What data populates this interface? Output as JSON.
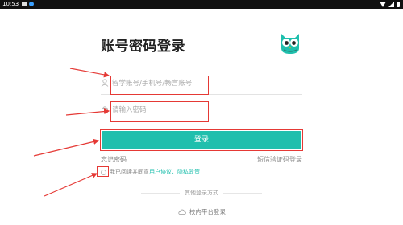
{
  "status_bar": {
    "time": "10:53"
  },
  "page": {
    "title": "账号密码登录"
  },
  "form": {
    "account_placeholder": "智学账号/手机号/畅言账号",
    "password_placeholder": "请输入密码",
    "login_label": "登录"
  },
  "links": {
    "forgot_password": "忘记密码",
    "sms_login": "短信验证码登录"
  },
  "agreement": {
    "prefix": "我已阅读并同意",
    "user_agreement": "用户协议",
    "separator": "、",
    "privacy_policy": "隐私政策"
  },
  "other_login": {
    "label": "其他登录方式",
    "campus": "校内平台登录"
  },
  "colors": {
    "accent": "#1fbfad",
    "annotation": "#e53935"
  }
}
